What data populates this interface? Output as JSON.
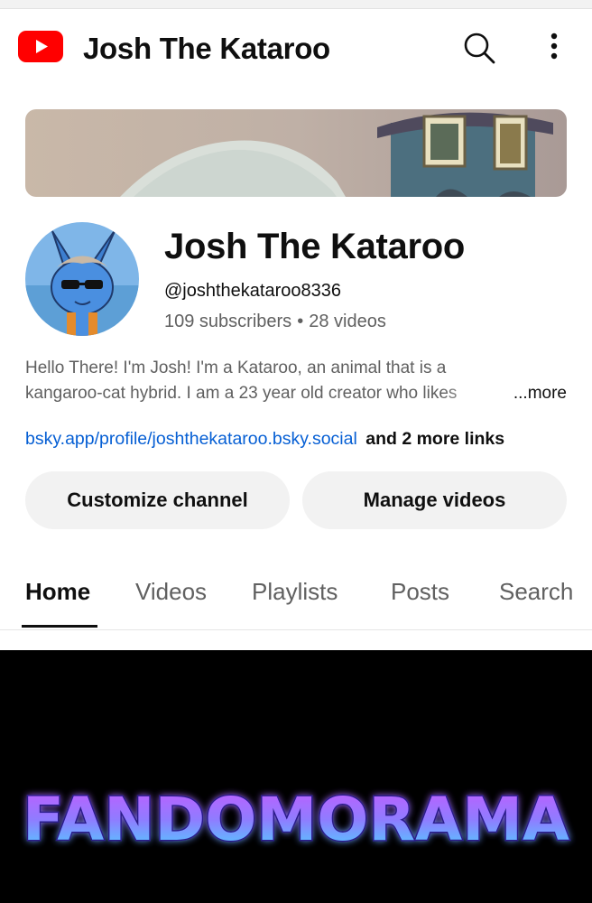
{
  "topbar": {
    "title": "Josh The Kataroo",
    "icons": {
      "logo": "youtube-logo-icon",
      "search": "search-icon",
      "more": "more-vertical-icon"
    },
    "colors": {
      "logo_red": "#ff0000"
    }
  },
  "channel": {
    "name": "Josh The Kataroo",
    "handle": "@joshthekataroo8336",
    "subscribers": "109 subscribers",
    "separator": "•",
    "videos": "28 videos",
    "description_line1": "Hello There! I'm Josh! I'm a Kataroo, an animal that is a",
    "description_line2": "kangaroo-cat hybrid. I am a 23 year old creator who likes",
    "more_label": "...more",
    "link": "bsky.app/profile/joshthekataroo.bsky.social",
    "more_links": "and 2 more links"
  },
  "actions": {
    "customize": "Customize channel",
    "manage": "Manage videos"
  },
  "tabs": [
    {
      "label": "Home",
      "active": true
    },
    {
      "label": "Videos",
      "active": false
    },
    {
      "label": "Playlists",
      "active": false
    },
    {
      "label": "Posts",
      "active": false
    },
    {
      "label": "Search",
      "active": false
    }
  ],
  "featured": {
    "logo_text": "FANDOMORAMA",
    "colors": {
      "background": "#000000",
      "text_top": "#c45cff",
      "text_bottom": "#4ad7ff"
    }
  },
  "colors": {
    "link": "#065fd4",
    "secondary_text": "#606060",
    "button_bg": "#f2f2f2"
  }
}
